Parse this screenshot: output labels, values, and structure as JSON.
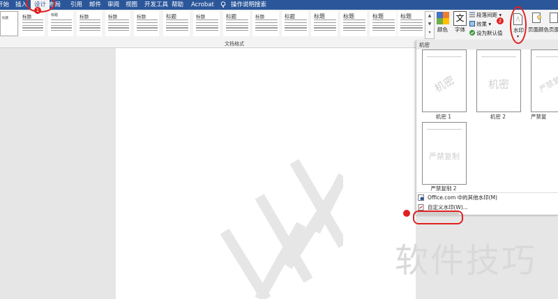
{
  "menu": {
    "tabs": [
      "开始",
      "插入",
      "设计",
      "布局",
      "引用",
      "邮件",
      "审阅",
      "视图",
      "开发工具",
      "帮助",
      "Acrobat"
    ],
    "active_tab": "设计",
    "search_label": "操作说明搜索"
  },
  "ribbon": {
    "style_gallery": [
      {
        "title": "标题"
      },
      {
        "title": "标题"
      },
      {
        "title": "标题"
      },
      {
        "title": "标题"
      },
      {
        "title": "标题"
      },
      {
        "title": "标题"
      },
      {
        "title": "标题"
      },
      {
        "title": "标题"
      },
      {
        "title": "标题"
      },
      {
        "title": "标题"
      },
      {
        "title": "标题"
      },
      {
        "title": "标题"
      },
      {
        "title": "标题"
      },
      {
        "title": "标题"
      },
      {
        "title": "标题"
      }
    ],
    "first_thumb_title": "标题",
    "group_label": "文档格式",
    "colors_label": "颜色",
    "fonts_label": "字体",
    "paragraph_spacing_label": "段落间距 ▾",
    "effects_label": "效果 ▾",
    "set_default_label": "设为默认值",
    "watermark_label": "水印",
    "page_color_label": "页面颜色",
    "page_border_label": "页面"
  },
  "watermark_panel": {
    "section_title": "机密",
    "items": [
      {
        "label": "机密 1",
        "text": "机密"
      },
      {
        "label": "机密 2",
        "text": "机密"
      },
      {
        "label": "严禁复",
        "text": "严禁复制"
      },
      {
        "label": "严禁复制 2",
        "text": "严禁复制"
      }
    ],
    "menu": {
      "office_more": "Office.com 中的其他水印(M)",
      "custom": "自定义水印(W)..."
    }
  },
  "annotations": {
    "badge_1": "1",
    "badge_2": "2"
  },
  "overlay_watermark": "软件技巧",
  "colors": {
    "menubar": "#2b579a",
    "ribbon_bg": "#f3f3f3",
    "annotation": "#e02020"
  }
}
